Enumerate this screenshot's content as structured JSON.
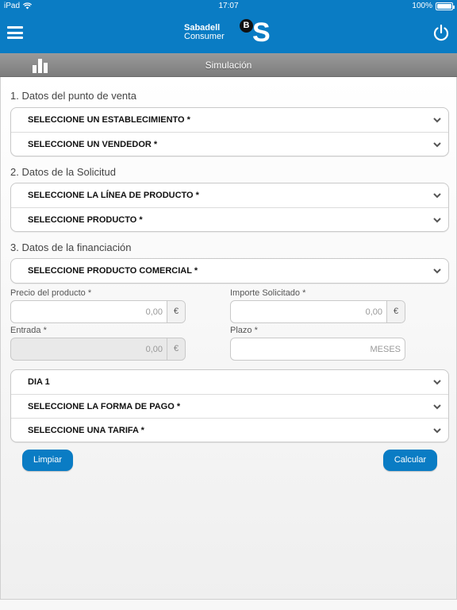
{
  "status": {
    "device": "iPad",
    "time": "17:07",
    "battery": "100%"
  },
  "header": {
    "brand_line1": "Sabadell",
    "brand_line2": "Consumer",
    "logo_letter_small": "B",
    "logo_letter_big": "S",
    "color": "#0a7cc4",
    "icons": {
      "menu": "hamburger-menu-icon",
      "power": "power-icon"
    }
  },
  "subheader": {
    "title": "Simulación",
    "icon": "bar-chart-icon"
  },
  "sections": {
    "s1": {
      "title": "1. Datos del punto de venta",
      "rows": [
        "SELECCIONE UN ESTABLECIMIENTO *",
        "SELECCIONE UN VENDEDOR *"
      ]
    },
    "s2": {
      "title": "2. Datos de la Solicitud",
      "rows": [
        "SELECCIONE LA LÍNEA DE PRODUCTO *",
        "SELECCIONE PRODUCTO *"
      ]
    },
    "s3": {
      "title": "3. Datos de la financiación",
      "rows": [
        "SELECCIONE PRODUCTO COMERCIAL *"
      ]
    }
  },
  "fields": {
    "precio": {
      "label": "Precio del producto *",
      "value": "0,00",
      "unit": "€"
    },
    "importe": {
      "label": "Importe Solicitado *",
      "value": "0,00",
      "unit": "€"
    },
    "entrada": {
      "label": "Entrada *",
      "value": "0,00",
      "unit": "€"
    },
    "plazo": {
      "label": "Plazo *",
      "placeholder": "MESES"
    }
  },
  "payment_rows": [
    "DIA 1",
    "SELECCIONE LA FORMA DE PAGO *",
    "SELECCIONE UNA TARIFA *"
  ],
  "buttons": {
    "clear": "Limpiar",
    "calculate": "Calcular"
  }
}
